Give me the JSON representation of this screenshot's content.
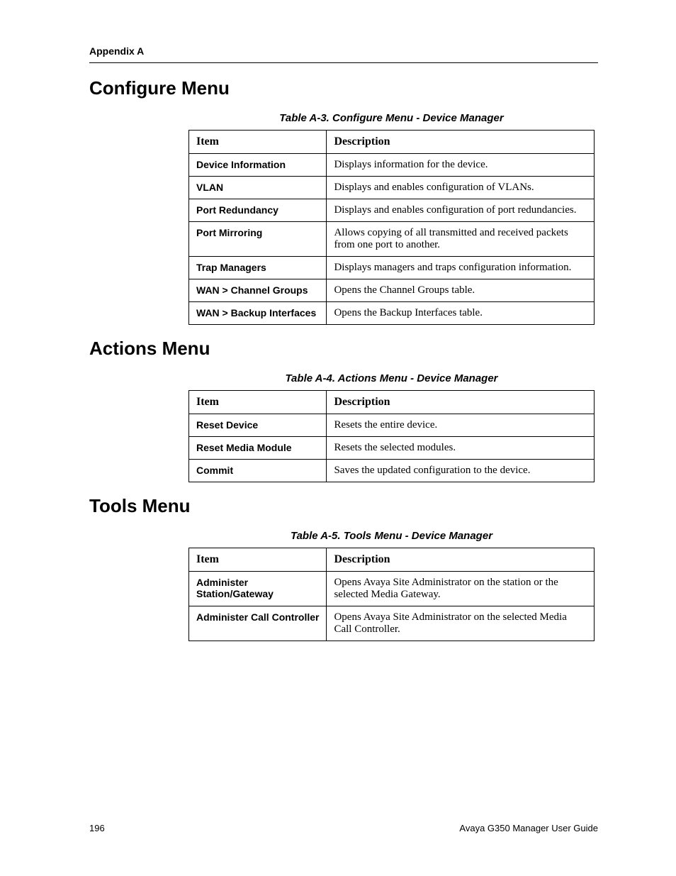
{
  "header": {
    "running": "Appendix A"
  },
  "sections": {
    "configure": {
      "title": "Configure Menu",
      "caption": "Table A-3.  Configure Menu - Device Manager",
      "columns": {
        "item": "Item",
        "desc": "Description"
      },
      "rows": [
        {
          "item": "Device Information",
          "desc": "Displays information for the device."
        },
        {
          "item": "VLAN",
          "desc": "Displays and enables configuration of VLANs."
        },
        {
          "item": "Port Redundancy",
          "desc": "Displays and enables configuration of port redundancies."
        },
        {
          "item": "Port Mirroring",
          "desc": "Allows copying of all transmitted and received packets from one port to another."
        },
        {
          "item": "Trap Managers",
          "desc": "Displays managers and traps configuration information."
        },
        {
          "item": "WAN > Channel Groups",
          "desc": "Opens the Channel Groups table."
        },
        {
          "item": "WAN > Backup Interfaces",
          "desc": "Opens the Backup Interfaces table."
        }
      ]
    },
    "actions": {
      "title": "Actions Menu",
      "caption": "Table A-4.  Actions Menu - Device Manager",
      "columns": {
        "item": "Item",
        "desc": "Description"
      },
      "rows": [
        {
          "item": "Reset Device",
          "desc": "Resets the entire device."
        },
        {
          "item": "Reset Media Module",
          "desc": "Resets the selected modules."
        },
        {
          "item": "Commit",
          "desc": "Saves the updated configuration to the device."
        }
      ]
    },
    "tools": {
      "title": "Tools Menu",
      "caption": "Table A-5.  Tools Menu - Device Manager",
      "columns": {
        "item": "Item",
        "desc": "Description"
      },
      "rows": [
        {
          "item": "Administer Station/Gateway",
          "desc": "Opens Avaya Site Administrator on the station or the selected Media Gateway."
        },
        {
          "item": "Administer Call Controller",
          "desc": "Opens Avaya Site Administrator on the selected Media Call Controller."
        }
      ]
    }
  },
  "footer": {
    "page": "196",
    "guide": "Avaya G350 Manager User Guide"
  }
}
